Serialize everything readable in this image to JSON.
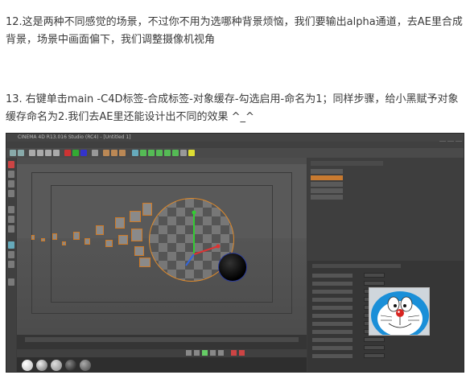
{
  "article": {
    "paragraph_12": "12.这是两种不同感觉的场景，不过你不用为选哪种背景烦恼，我们要输出alpha通道，去AE里合成背景，场景中画面偏下，我们调整摄像机视角",
    "paragraph_13": "13. 右键单击main -C4D标签-合成标签-对象缓存-勾选启用-命名为1；同样步骤，给小黑赋予对象缓存命名为2.我们去AE里还能设计出不同的效果 ^_^"
  },
  "screenshot": {
    "window_title": "CINEMA 4D R13.016 Studio (RC4) - [Untitled 1]",
    "colors": {
      "panel_bg": "#3b3b3b",
      "viewport_bg": "#595959",
      "selection_outline": "#e08a2a",
      "black_ball_rim": "#2c3c9a",
      "doraemon_blue": "#1a8fd8"
    }
  }
}
